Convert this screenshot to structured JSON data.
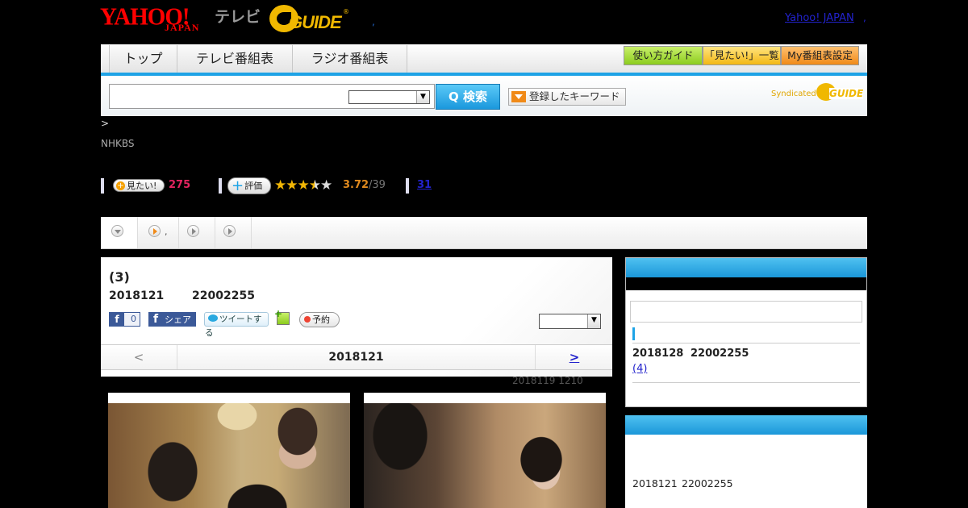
{
  "header": {
    "yahoo_logo_text": "YAHOO!",
    "yahoo_logo_sub": "JAPAN",
    "tv_label": "テレビ",
    "gguide_logo_text": "GUIDE",
    "comma": ",",
    "yahoo_japan_link": "Yahoo! JAPAN",
    "comma2": ","
  },
  "nav": {
    "tabs": [
      "トップ",
      "テレビ番組表",
      "ラジオ番組表"
    ],
    "buttons": [
      "使い方ガイド",
      "「見たい!」一覧",
      "My番組表設定"
    ]
  },
  "search": {
    "button_label": "Q 検索",
    "keyword_button": "登録したキーワード",
    "syndicated": "Syndicated",
    "synd_logo": "GUIDE"
  },
  "breadcrumb": ">",
  "channel": "NHKBS",
  "stats": {
    "mitai_label": "見たい!",
    "mitai_count": "275",
    "hyoka_label": "評価",
    "stars": [
      "★",
      "★",
      "★",
      "★",
      "★"
    ],
    "rating": 3.72,
    "rating_text": "3.72",
    "rating_count": "/39",
    "review_count": "31"
  },
  "tabs": {
    "tab2_suffix": ","
  },
  "program": {
    "title": "(3)",
    "date": "2018121",
    "time": "22002255",
    "fb_like_count": "0",
    "fb_share": "シェア",
    "tweet": "ツイートする",
    "yoyaku": "予約",
    "datenav_prev": "<",
    "datenav_date": "2018121",
    "datenav_next": ">",
    "updated": "2018119  1210"
  },
  "sidebar": {
    "box1": {
      "date": "2018128",
      "time": "22002255",
      "link": "(4)"
    },
    "box2": {
      "date": "2018121",
      "time": "22002255"
    }
  },
  "colors": {
    "accent_blue": "#1ea3e6",
    "mitai_pink": "#e3245f",
    "rating_orange": "#e08a1e",
    "link_blue": "#2222cc",
    "star_gold": "#f2b705"
  }
}
